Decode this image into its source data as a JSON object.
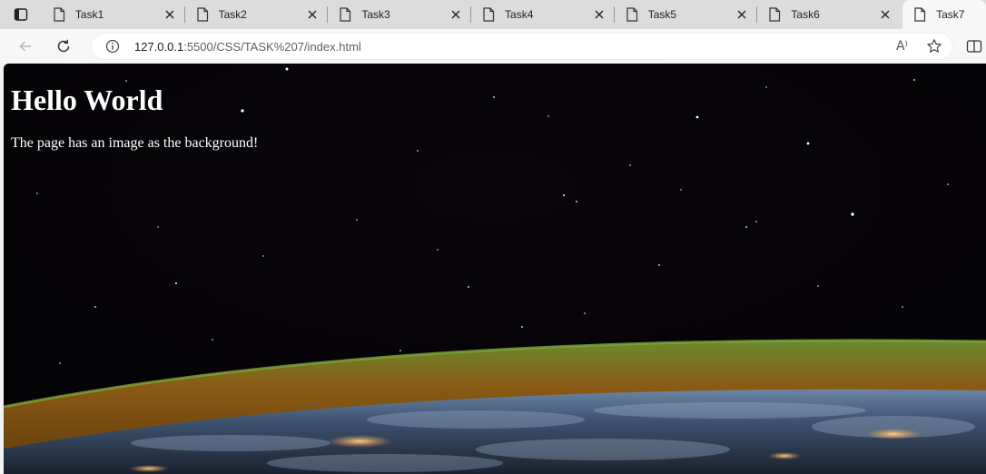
{
  "tabs": [
    {
      "label": "Task1",
      "active": false
    },
    {
      "label": "Task2",
      "active": false
    },
    {
      "label": "Task3",
      "active": false
    },
    {
      "label": "Task4",
      "active": false
    },
    {
      "label": "Task5",
      "active": false
    },
    {
      "label": "Task6",
      "active": false
    },
    {
      "label": "Task7",
      "active": true
    }
  ],
  "toolbar": {
    "url_host": "127.0.0.1",
    "url_rest": ":5500/CSS/TASK%207/index.html",
    "read_aloud_label": "A⁾"
  },
  "page": {
    "heading": "Hello World",
    "paragraph": "The page has an image as the background!"
  },
  "colors": {
    "tabstrip_bg": "#dcdcdc",
    "toolbar_bg": "#f7f7f7",
    "space_bg": "#050306",
    "page_text": "#ffffff"
  },
  "icons": {
    "tab_actions": "tab-actions-icon",
    "tab_page": "page-icon",
    "tab_close": "close-icon",
    "back": "back-arrow-icon",
    "reload": "reload-icon",
    "site_info": "info-icon",
    "read_aloud": "read-aloud-icon",
    "favorite": "star-icon",
    "split_screen": "split-screen-icon"
  }
}
